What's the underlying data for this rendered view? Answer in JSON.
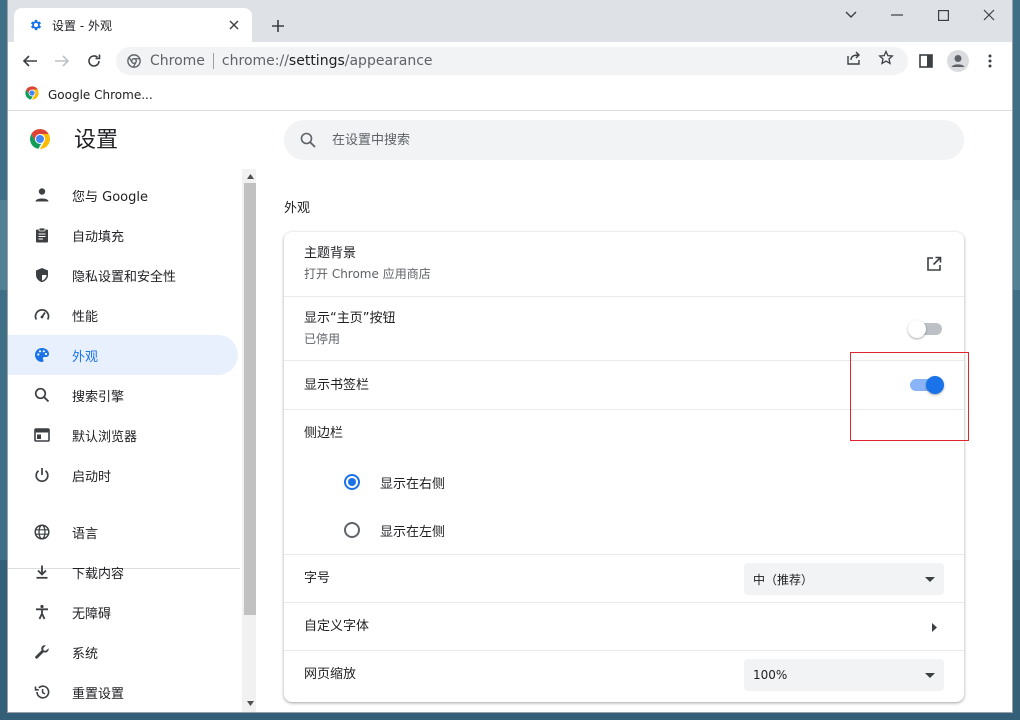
{
  "tab": {
    "title": "设置 - 外观"
  },
  "toolbar": {
    "site_name": "Chrome",
    "url_prefix": "chrome://",
    "url_path": "settings",
    "url_suffix": "/appearance"
  },
  "bookmarks": [
    {
      "label": "Google Chrome..."
    }
  ],
  "settings": {
    "title": "设置",
    "search_placeholder": "在设置中搜索"
  },
  "nav": {
    "items": [
      {
        "label": "您与 Google",
        "icon": "person-icon"
      },
      {
        "label": "自动填充",
        "icon": "clipboard-icon"
      },
      {
        "label": "隐私设置和安全性",
        "icon": "shield-icon"
      },
      {
        "label": "性能",
        "icon": "speedometer-icon"
      },
      {
        "label": "外观",
        "icon": "palette-icon",
        "active": true
      },
      {
        "label": "搜索引擎",
        "icon": "search-icon"
      },
      {
        "label": "默认浏览器",
        "icon": "browser-icon"
      },
      {
        "label": "启动时",
        "icon": "power-icon"
      },
      {
        "label": "语言",
        "icon": "globe-icon"
      },
      {
        "label": "下载内容",
        "icon": "download-icon"
      },
      {
        "label": "无障碍",
        "icon": "accessibility-icon"
      },
      {
        "label": "系统",
        "icon": "wrench-icon"
      },
      {
        "label": "重置设置",
        "icon": "restore-icon"
      }
    ]
  },
  "appearance": {
    "section_title": "外观",
    "theme": {
      "label": "主题背景",
      "sub": "打开 Chrome 应用商店"
    },
    "home_button": {
      "label": "显示“主页”按钮",
      "sub": "已停用",
      "on": false
    },
    "bookmarks_bar": {
      "label": "显示书签栏",
      "on": true
    },
    "side_panel": {
      "label": "侧边栏",
      "options": [
        {
          "label": "显示在右侧",
          "checked": true
        },
        {
          "label": "显示在左侧",
          "checked": false
        }
      ]
    },
    "font_size": {
      "label": "字号",
      "value": "中（推荐）"
    },
    "custom_fonts": {
      "label": "自定义字体"
    },
    "page_zoom": {
      "label": "网页缩放",
      "value": "100%"
    }
  },
  "colors": {
    "accent": "#1a73e8",
    "highlight": "#e0242b",
    "tabbar": "#dee1e6"
  }
}
